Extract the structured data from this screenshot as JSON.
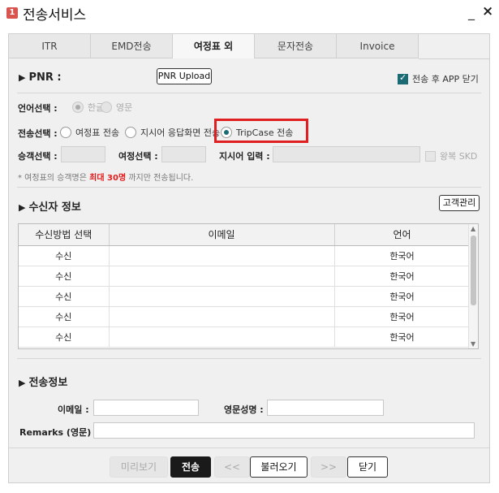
{
  "window": {
    "badge": "1",
    "title": "전송서비스",
    "minimize": "_",
    "close": "×"
  },
  "tabs": [
    {
      "label": "ITR",
      "active": false
    },
    {
      "label": "EMD전송",
      "active": false
    },
    {
      "label": "여정표 외",
      "active": true
    },
    {
      "label": "문자전송",
      "active": false
    },
    {
      "label": "Invoice",
      "active": false
    }
  ],
  "pnr": {
    "title": "PNR :",
    "upload_button": "PNR Upload",
    "close_after_send_label": "전송 후 APP 닫기",
    "close_after_send_checked": true
  },
  "language": {
    "label": "언어선택 :",
    "options": [
      "한글",
      "영문"
    ],
    "selected": "한글"
  },
  "send_select": {
    "label": "전송선택 :",
    "options": [
      "여정표 전송",
      "지시어 응답화면 전송",
      "TripCase 전송"
    ],
    "selected": "TripCase 전송"
  },
  "filters": {
    "passenger_label": "승객선택 :",
    "itinerary_label": "여정선택 :",
    "command_label": "지시어 입력 :",
    "repeat_skd_label": "왕복 SKD"
  },
  "note": {
    "prefix": "* 여정표의 승객명은 ",
    "highlight": "최대 30명",
    "suffix": " 까지만 전송됩니다."
  },
  "recipient": {
    "title": "수신자 정보",
    "manage_button": "고객관리",
    "columns": [
      "수신방법 선택",
      "이메일",
      "언어"
    ],
    "rows": [
      {
        "method": "수신",
        "email": "",
        "lang": "한국어"
      },
      {
        "method": "수신",
        "email": "",
        "lang": "한국어"
      },
      {
        "method": "수신",
        "email": "",
        "lang": "한국어"
      },
      {
        "method": "수신",
        "email": "",
        "lang": "한국어"
      },
      {
        "method": "수신",
        "email": "",
        "lang": "한국어"
      }
    ]
  },
  "send_info": {
    "title": "전송정보",
    "email_label": "이메일 :",
    "eng_name_label": "영문성명 :",
    "remarks_label": "Remarks (영문) :"
  },
  "footer": {
    "preview": "미리보기",
    "send": "전송",
    "prev": "<<",
    "load": "불러오기",
    "next": ">>",
    "close": "닫기"
  }
}
